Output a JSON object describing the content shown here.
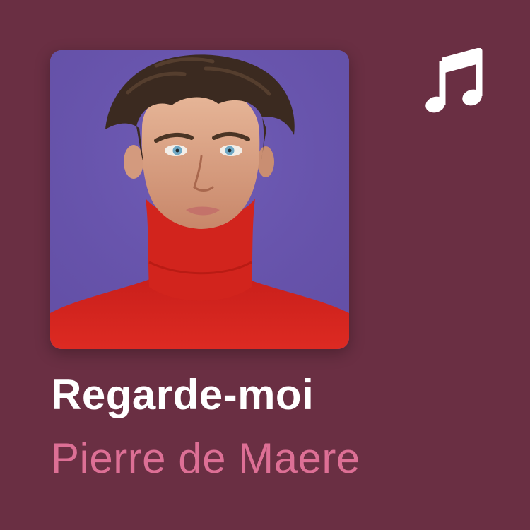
{
  "track": {
    "title": "Regarde-moi",
    "artist": "Pierre de Maere"
  },
  "icons": {
    "badge": "music-note-icon",
    "artwork": "album-cover-portrait"
  },
  "colors": {
    "background": "#6a2f43",
    "title": "#ffffff",
    "artist": "#dd6f95",
    "artwork_background": "#6a56b0",
    "sweater": "#d8261f"
  }
}
